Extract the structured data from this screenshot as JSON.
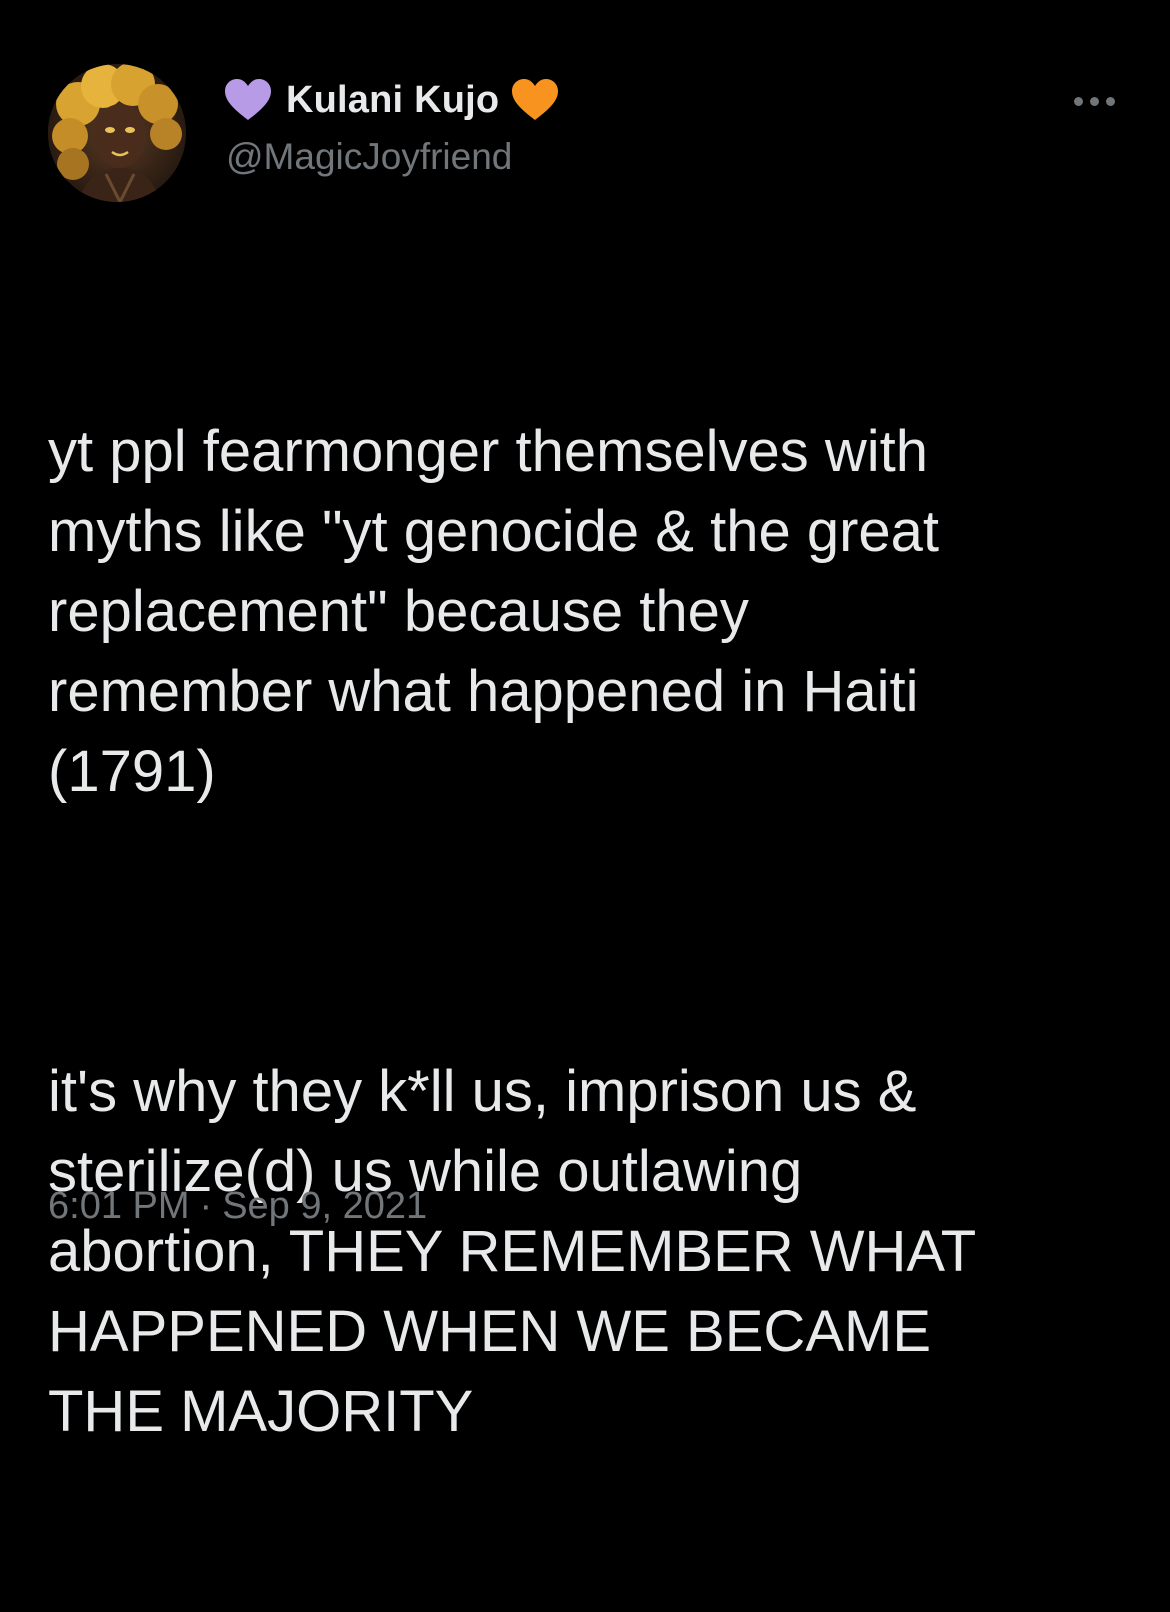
{
  "tweet": {
    "display_name": "Kulani Kujo",
    "handle": "@MagicJoyfriend",
    "name_emoji_left": "purple-heart",
    "name_emoji_right": "orange-heart",
    "body_paragraphs": [
      "yt ppl fearmonger themselves with\nmyths like \"yt genocide & the great\nreplacement\" because they\nremember what happened in Haiti\n(1791)",
      "it's why they k*ll us, imprison us &\nsterilize(d) us while outlawing\nabortion, THEY REMEMBER WHAT\nHAPPENED WHEN WE BECAME\nTHE MAJORITY"
    ],
    "time": "6:01 PM",
    "separator": "·",
    "date": "Sep 9, 2021"
  },
  "colors": {
    "background": "#000000",
    "primary_text": "#e7e9ea",
    "secondary_text": "#71767b",
    "purple_heart": "#b79be6",
    "orange_heart": "#f7931e"
  },
  "icons": {
    "more": "more-horizontal-icon",
    "avatar": "avatar-image"
  }
}
